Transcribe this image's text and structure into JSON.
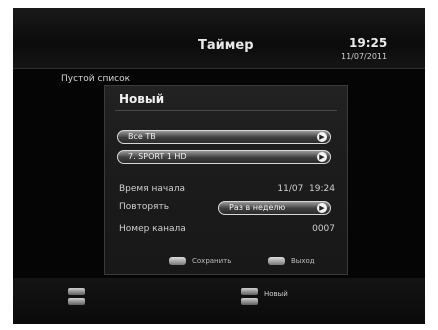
{
  "header": {
    "title": "Таймер",
    "time": "19:25",
    "date": "11/07/2011"
  },
  "list": {
    "empty_text": "Пустой список"
  },
  "dialog": {
    "title": "Новый",
    "channel_group": "Все ТВ",
    "channel": "7. SPORT 1 HD",
    "start_time_label": "Время начала",
    "start_time_value": "11/07  19:24",
    "repeat_label": "Повторять",
    "repeat_value": "Раз в неделю",
    "channel_number_label": "Номер канала",
    "channel_number_value": "0007",
    "footer": {
      "save_label": "Сохранить",
      "exit_label": "Выход"
    }
  },
  "bottom": {
    "new_label": "Новый"
  },
  "colors": {
    "background": "#050505",
    "text": "#d0d0d0",
    "pill_border": "#d8d8d8"
  }
}
